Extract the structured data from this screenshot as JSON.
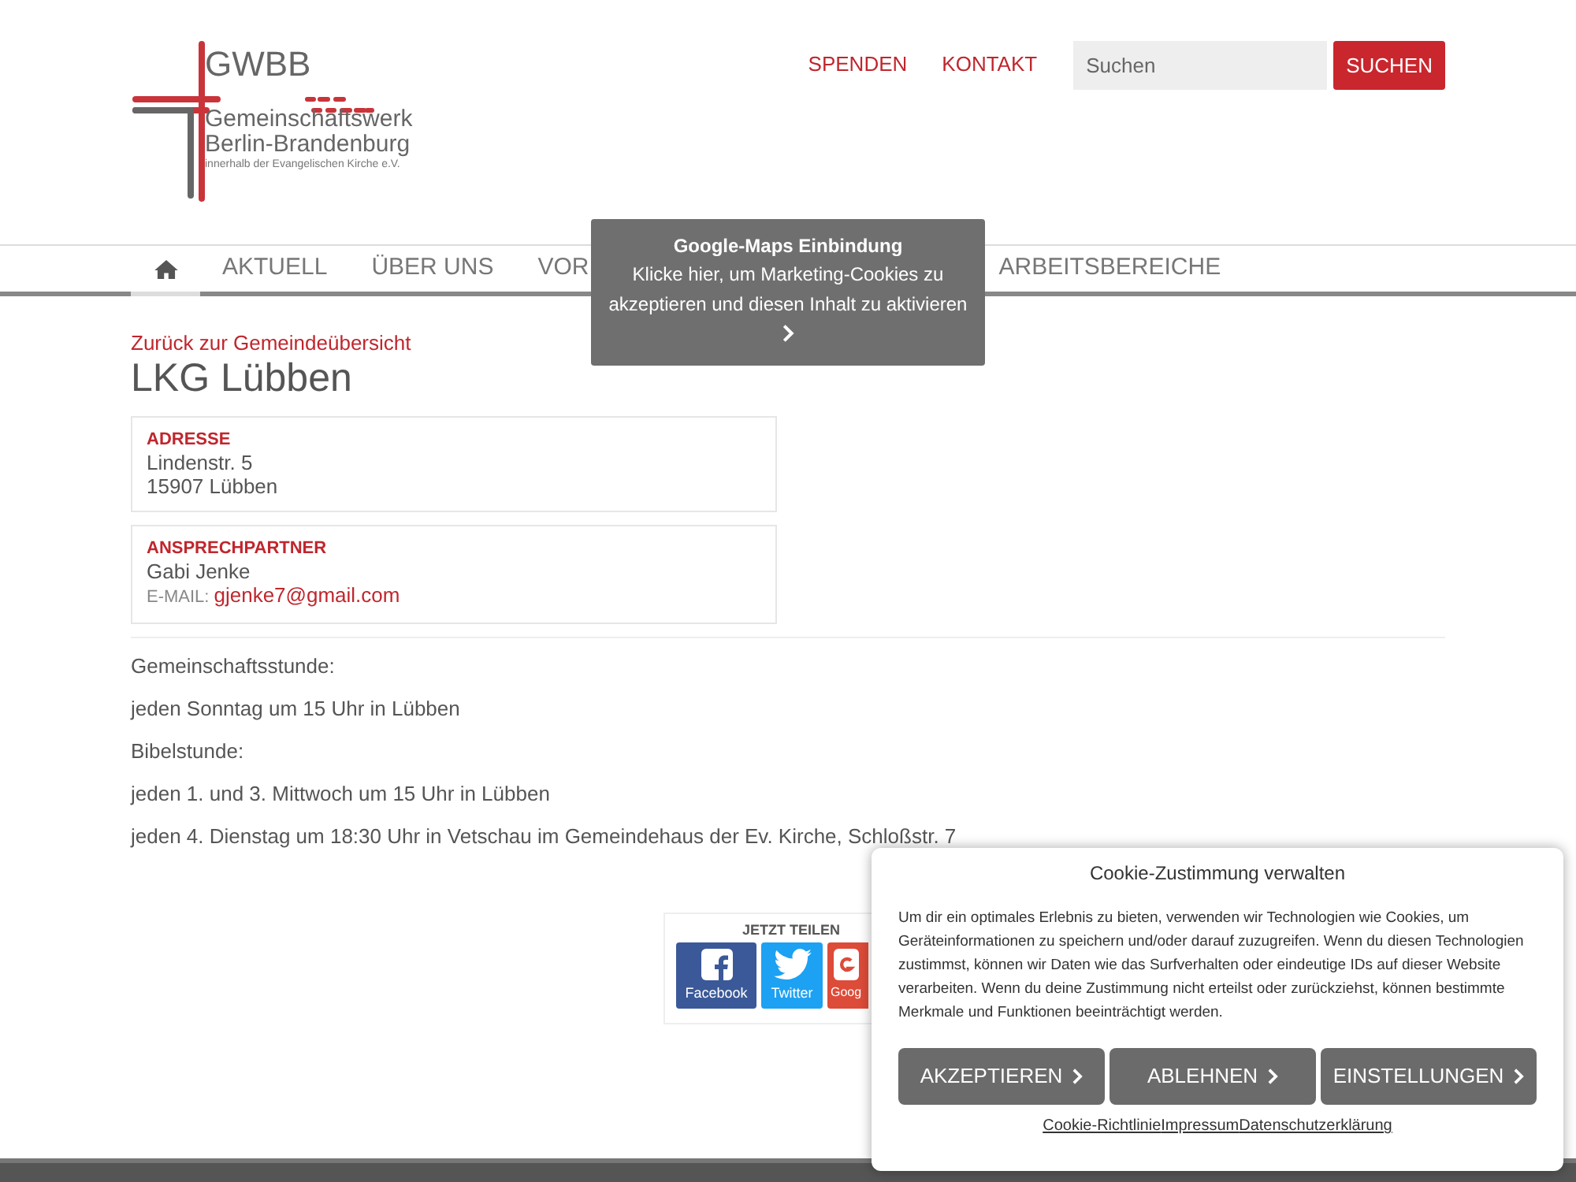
{
  "logo": {
    "abbr": "GWBB",
    "name_line_1": "Gemeinschaftswerk",
    "name_line_2": "Berlin-Brandenburg",
    "tagline": "innerhalb der Evangelischen Kirche e.V."
  },
  "top_links": [
    "SPENDEN",
    "KONTAKT"
  ],
  "search": {
    "placeholder": "Suchen",
    "button": "SUCHEN"
  },
  "nav": [
    {
      "kind": "home",
      "selected": true
    },
    {
      "label": "AKTUELL",
      "kind": "text",
      "selected": false
    },
    {
      "label": "ÜBER UNS",
      "kind": "text",
      "selected": false
    },
    {
      "label": "VOR",
      "kind": "text",
      "selected": false
    },
    {
      "label": "ARBEITSBEREICHE",
      "kind": "text",
      "selected": false
    }
  ],
  "maps_notice": {
    "title": "Google-Maps Einbindung",
    "text": "Klicke hier, um Marketing-Cookies zu akzeptieren und diesen Inhalt zu aktivieren"
  },
  "back_link": "Zurück zur Gemeindeübersicht",
  "title": "LKG Lübben",
  "address": {
    "heading": "ADRESSE",
    "lines": [
      "Lindenstr. 5",
      "15907 Lübben"
    ]
  },
  "contact": {
    "heading": "ANSPRECHPARTNER",
    "name": "Gabi Jenke",
    "email_label": "E-MAIL:",
    "email": "gjenke7@gmail.com"
  },
  "schedule": [
    "Gemeinschaftsstunde:",
    "jeden Sonntag um 15 Uhr in Lübben",
    "Bibelstunde:",
    "jeden 1. und 3. Mittwoch um 15 Uhr in Lübben",
    "jeden 4. Dienstag um 18:30 Uhr in Vetschau im Gemeindehaus der Ev. Kirche, Schloßstr. 7"
  ],
  "share": {
    "heading": "JETZT TEILEN",
    "buttons": [
      {
        "kind": "facebook",
        "label": "Facebook"
      },
      {
        "kind": "twitter",
        "label": "Twitter"
      },
      {
        "kind": "google",
        "label": "Goog"
      }
    ]
  },
  "cookie": {
    "title": "Cookie-Zustimmung verwalten",
    "text": "Um dir ein optimales Erlebnis zu bieten, verwenden wir Technologien wie Cookies, um Geräteinformationen zu speichern und/oder darauf zuzugreifen. Wenn du diesen Technologien zustimmst, können wir Daten wie das Surfverhalten oder eindeutige IDs auf dieser Website verarbeiten. Wenn du deine Zustimmung nicht erteilst oder zurückziehst, können bestimmte Merkmale und Funktionen beeinträchtigt werden.",
    "buttons": [
      "AKZEPTIEREN",
      "ABLEHNEN",
      "EINSTELLUNGEN"
    ],
    "links": [
      "Cookie-Richtlinie",
      "Impressum",
      "Datenschutzerklärung"
    ]
  }
}
